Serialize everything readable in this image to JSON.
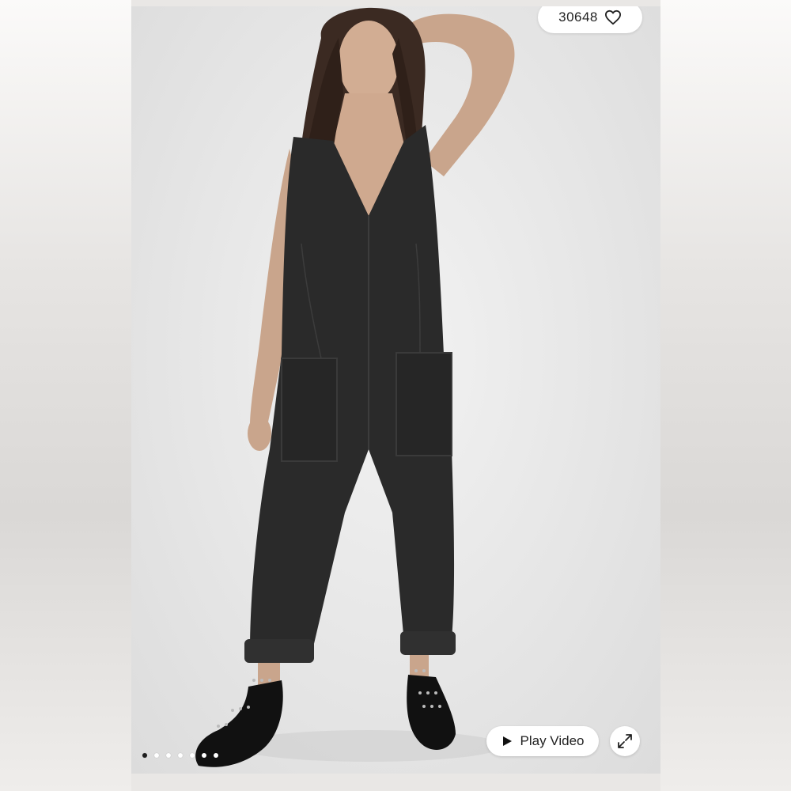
{
  "listing": {
    "like_count": "30648",
    "like_icon": "heart-outline-icon"
  },
  "gallery": {
    "image_count": 7,
    "active_index": 0,
    "play_video_label": "Play Video",
    "play_icon": "play-icon",
    "expand_icon": "expand-icon"
  },
  "colors": {
    "pill_background": "#ffffff",
    "text": "#222222",
    "active_dot": "#1e1e1e",
    "inactive_dot": "#ffffff",
    "garment": "#2a2a2a"
  }
}
